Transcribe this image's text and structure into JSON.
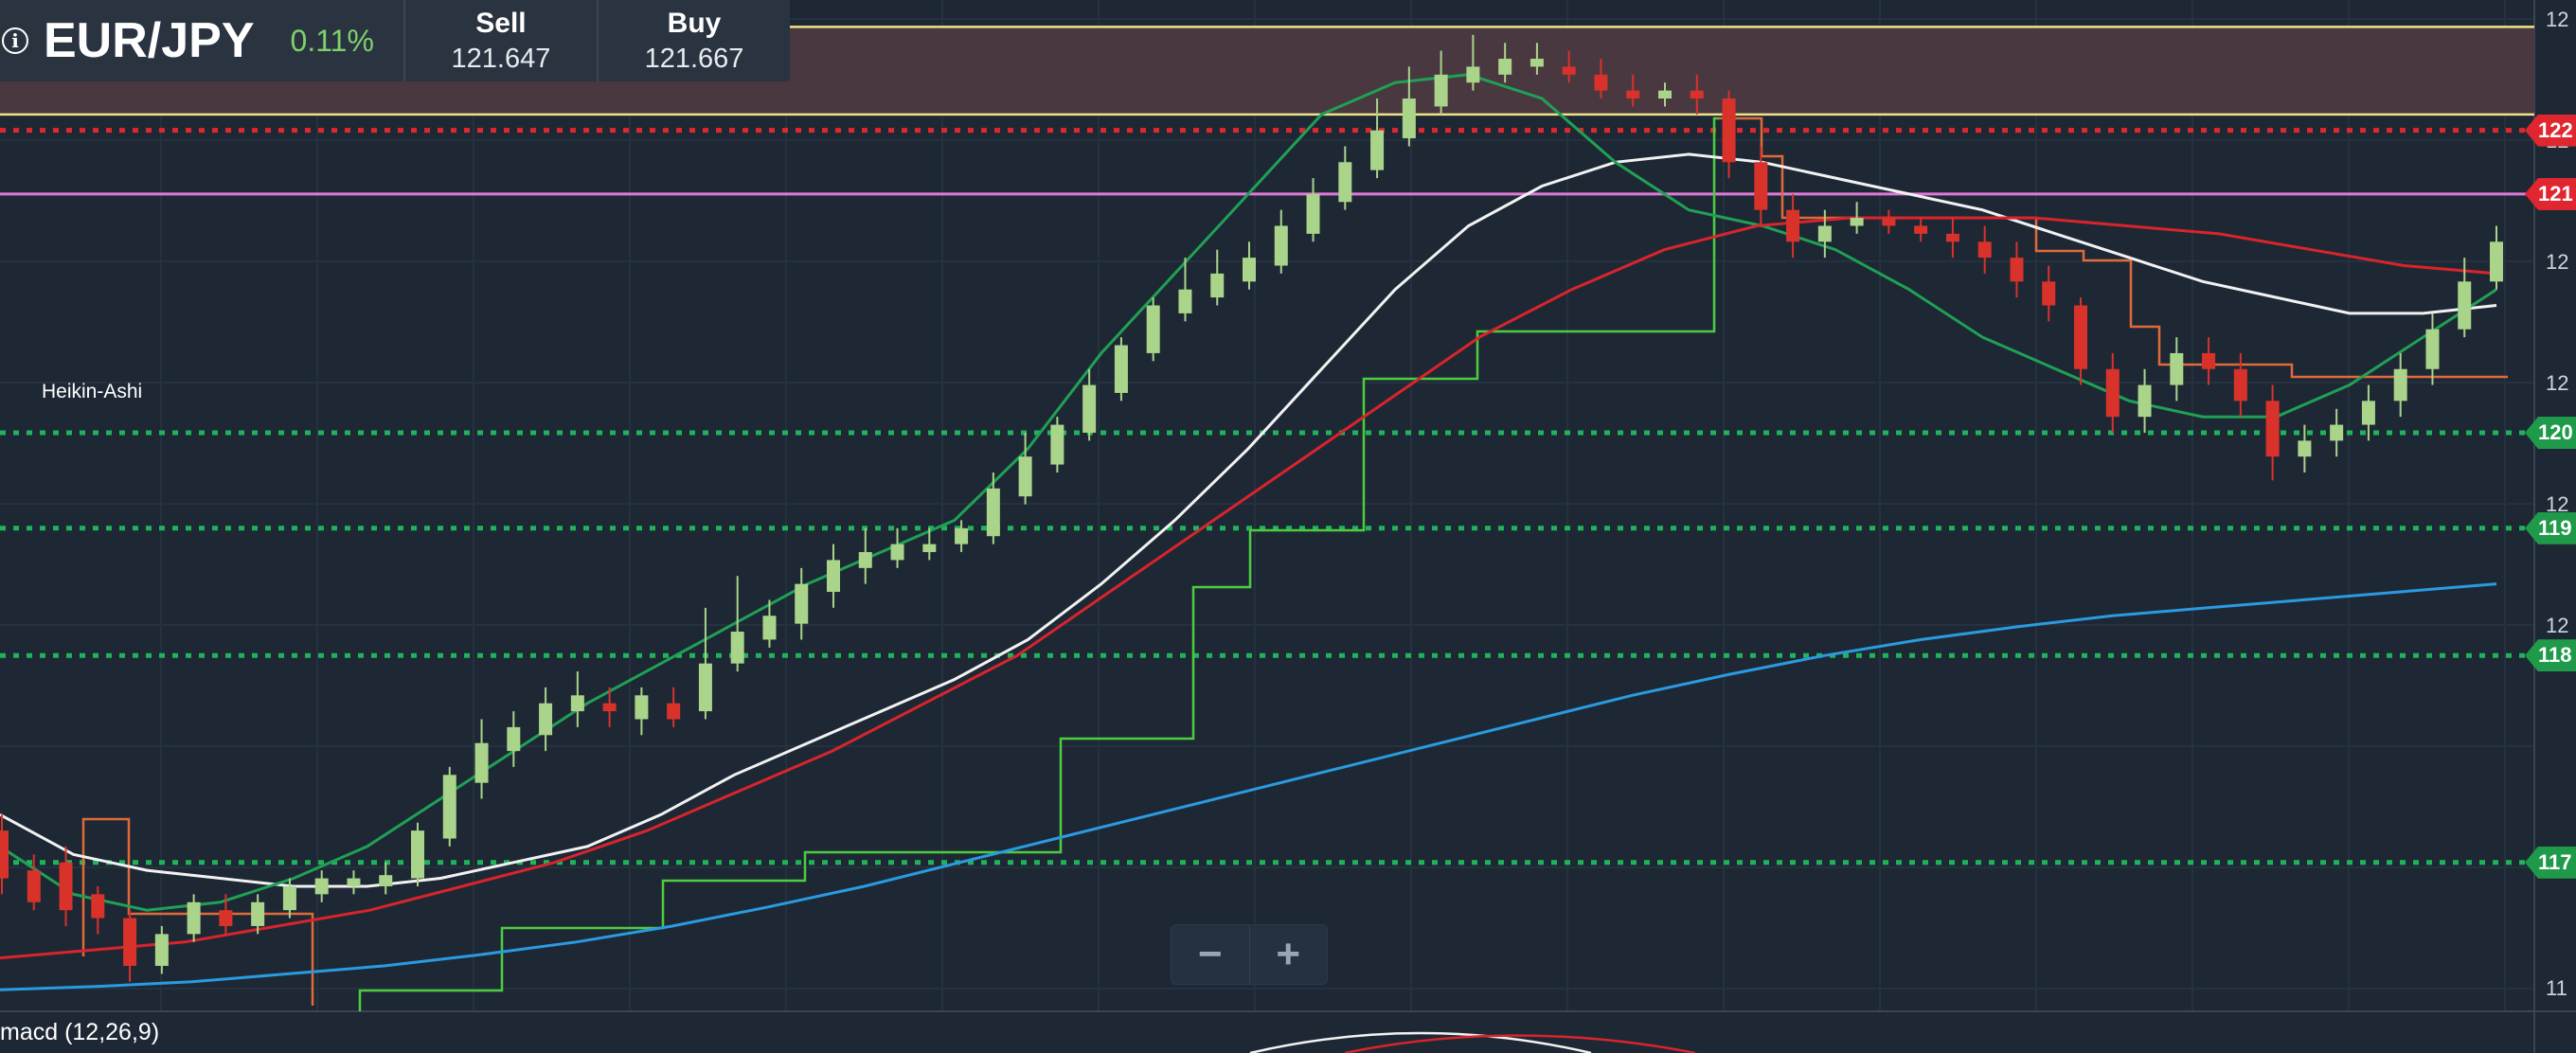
{
  "quote": {
    "symbol": "EUR/JPY",
    "change": "0.11%",
    "sell_label": "Sell",
    "sell_value": "121.647",
    "buy_label": "Buy",
    "buy_value": "121.667"
  },
  "study_label": "Heikin-Ashi",
  "macd_label": "macd (12,26,9)",
  "zoom": {
    "minus": "−",
    "plus": "+"
  },
  "icons": {
    "info": "info-icon",
    "zoom_out": "minus-icon",
    "zoom_in": "plus-icon"
  },
  "axis_ticks": [
    "12",
    "12",
    "12",
    "12",
    "12",
    "12",
    "11",
    "11",
    "11"
  ],
  "price_tags": [
    {
      "text": "122",
      "color": "#e0272f"
    },
    {
      "text": "121",
      "color": "#e0272f"
    },
    {
      "text": "120",
      "color": "#1f9a4a"
    },
    {
      "text": "119",
      "color": "#1f9a4a"
    },
    {
      "text": "118",
      "color": "#1f9a4a"
    },
    {
      "text": "117",
      "color": "#1f9a4a"
    }
  ],
  "colors": {
    "background": "#1e2835",
    "bull": "#a9d48a",
    "bear": "#d9322b",
    "ma_white": "#f2f2f2",
    "ma_green": "#1fa155",
    "ma_red": "#d9242c",
    "ma_blue": "#2a9be0",
    "step_green": "#4ccd3e",
    "step_orange": "#e06a3a",
    "resistance": "#e0272f",
    "support": "#1fb35a",
    "band": "#493840",
    "band_edge": "#efe28a",
    "hline": "#e07ad8"
  },
  "chart_data": {
    "type": "candlestick",
    "instrument": "EUR/JPY",
    "style": "Heikin-Ashi",
    "y_range": [
      116.6,
      122.8
    ],
    "horizontal_levels": {
      "resistance": [
        122.1
      ],
      "support": [
        120.2,
        119.6,
        118.8,
        117.5
      ],
      "band": [
        122.2,
        122.75
      ],
      "reference": [
        121.7
      ]
    },
    "candles": [
      {
        "o": 117.7,
        "c": 117.4,
        "h": 117.8,
        "l": 117.3
      },
      {
        "o": 117.45,
        "c": 117.25,
        "h": 117.55,
        "l": 117.2
      },
      {
        "o": 117.5,
        "c": 117.2,
        "h": 117.6,
        "l": 117.1
      },
      {
        "o": 117.3,
        "c": 117.15,
        "h": 117.35,
        "l": 117.05
      },
      {
        "o": 117.15,
        "c": 116.85,
        "h": 117.2,
        "l": 116.75
      },
      {
        "o": 116.85,
        "c": 117.05,
        "h": 117.1,
        "l": 116.8
      },
      {
        "o": 117.05,
        "c": 117.25,
        "h": 117.3,
        "l": 117.0
      },
      {
        "o": 117.2,
        "c": 117.1,
        "h": 117.3,
        "l": 117.05
      },
      {
        "o": 117.1,
        "c": 117.25,
        "h": 117.3,
        "l": 117.05
      },
      {
        "o": 117.2,
        "c": 117.35,
        "h": 117.4,
        "l": 117.15
      },
      {
        "o": 117.3,
        "c": 117.4,
        "h": 117.45,
        "l": 117.25
      },
      {
        "o": 117.35,
        "c": 117.4,
        "h": 117.45,
        "l": 117.3
      },
      {
        "o": 117.35,
        "c": 117.42,
        "h": 117.5,
        "l": 117.3
      },
      {
        "o": 117.4,
        "c": 117.7,
        "h": 117.75,
        "l": 117.35
      },
      {
        "o": 117.65,
        "c": 118.05,
        "h": 118.1,
        "l": 117.6
      },
      {
        "o": 118.0,
        "c": 118.25,
        "h": 118.4,
        "l": 117.9
      },
      {
        "o": 118.2,
        "c": 118.35,
        "h": 118.45,
        "l": 118.1
      },
      {
        "o": 118.3,
        "c": 118.5,
        "h": 118.6,
        "l": 118.2
      },
      {
        "o": 118.45,
        "c": 118.55,
        "h": 118.7,
        "l": 118.35
      },
      {
        "o": 118.5,
        "c": 118.45,
        "h": 118.6,
        "l": 118.35
      },
      {
        "o": 118.4,
        "c": 118.55,
        "h": 118.6,
        "l": 118.3
      },
      {
        "o": 118.5,
        "c": 118.4,
        "h": 118.6,
        "l": 118.35
      },
      {
        "o": 118.45,
        "c": 118.75,
        "h": 119.1,
        "l": 118.4
      },
      {
        "o": 118.75,
        "c": 118.95,
        "h": 119.3,
        "l": 118.7
      },
      {
        "o": 118.9,
        "c": 119.05,
        "h": 119.15,
        "l": 118.85
      },
      {
        "o": 119.0,
        "c": 119.25,
        "h": 119.35,
        "l": 118.9
      },
      {
        "o": 119.2,
        "c": 119.4,
        "h": 119.5,
        "l": 119.1
      },
      {
        "o": 119.35,
        "c": 119.45,
        "h": 119.6,
        "l": 119.25
      },
      {
        "o": 119.4,
        "c": 119.5,
        "h": 119.6,
        "l": 119.35
      },
      {
        "o": 119.45,
        "c": 119.5,
        "h": 119.6,
        "l": 119.4
      },
      {
        "o": 119.5,
        "c": 119.6,
        "h": 119.65,
        "l": 119.45
      },
      {
        "o": 119.55,
        "c": 119.85,
        "h": 119.95,
        "l": 119.5
      },
      {
        "o": 119.8,
        "c": 120.05,
        "h": 120.2,
        "l": 119.75
      },
      {
        "o": 120.0,
        "c": 120.25,
        "h": 120.3,
        "l": 119.95
      },
      {
        "o": 120.2,
        "c": 120.5,
        "h": 120.6,
        "l": 120.15
      },
      {
        "o": 120.45,
        "c": 120.75,
        "h": 120.8,
        "l": 120.4
      },
      {
        "o": 120.7,
        "c": 121.0,
        "h": 121.05,
        "l": 120.65
      },
      {
        "o": 120.95,
        "c": 121.1,
        "h": 121.3,
        "l": 120.9
      },
      {
        "o": 121.05,
        "c": 121.2,
        "h": 121.35,
        "l": 121.0
      },
      {
        "o": 121.15,
        "c": 121.3,
        "h": 121.4,
        "l": 121.1
      },
      {
        "o": 121.25,
        "c": 121.5,
        "h": 121.6,
        "l": 121.2
      },
      {
        "o": 121.45,
        "c": 121.7,
        "h": 121.8,
        "l": 121.4
      },
      {
        "o": 121.65,
        "c": 121.9,
        "h": 122.0,
        "l": 121.6
      },
      {
        "o": 121.85,
        "c": 122.1,
        "h": 122.3,
        "l": 121.8
      },
      {
        "o": 122.05,
        "c": 122.3,
        "h": 122.5,
        "l": 122.0
      },
      {
        "o": 122.25,
        "c": 122.45,
        "h": 122.6,
        "l": 122.2
      },
      {
        "o": 122.4,
        "c": 122.5,
        "h": 122.7,
        "l": 122.35
      },
      {
        "o": 122.45,
        "c": 122.55,
        "h": 122.65,
        "l": 122.4
      },
      {
        "o": 122.5,
        "c": 122.55,
        "h": 122.65,
        "l": 122.45
      },
      {
        "o": 122.5,
        "c": 122.45,
        "h": 122.6,
        "l": 122.4
      },
      {
        "o": 122.45,
        "c": 122.35,
        "h": 122.55,
        "l": 122.3
      },
      {
        "o": 122.35,
        "c": 122.3,
        "h": 122.45,
        "l": 122.25
      },
      {
        "o": 122.3,
        "c": 122.35,
        "h": 122.4,
        "l": 122.25
      },
      {
        "o": 122.35,
        "c": 122.3,
        "h": 122.45,
        "l": 122.2
      },
      {
        "o": 122.3,
        "c": 121.9,
        "h": 122.35,
        "l": 121.8
      },
      {
        "o": 121.9,
        "c": 121.6,
        "h": 122.0,
        "l": 121.5
      },
      {
        "o": 121.6,
        "c": 121.4,
        "h": 121.7,
        "l": 121.3
      },
      {
        "o": 121.4,
        "c": 121.5,
        "h": 121.6,
        "l": 121.3
      },
      {
        "o": 121.5,
        "c": 121.55,
        "h": 121.65,
        "l": 121.45
      },
      {
        "o": 121.55,
        "c": 121.5,
        "h": 121.6,
        "l": 121.45
      },
      {
        "o": 121.5,
        "c": 121.45,
        "h": 121.55,
        "l": 121.4
      },
      {
        "o": 121.45,
        "c": 121.4,
        "h": 121.55,
        "l": 121.3
      },
      {
        "o": 121.4,
        "c": 121.3,
        "h": 121.5,
        "l": 121.2
      },
      {
        "o": 121.3,
        "c": 121.15,
        "h": 121.4,
        "l": 121.05
      },
      {
        "o": 121.15,
        "c": 121.0,
        "h": 121.25,
        "l": 120.9
      },
      {
        "o": 121.0,
        "c": 120.6,
        "h": 121.05,
        "l": 120.5
      },
      {
        "o": 120.6,
        "c": 120.3,
        "h": 120.7,
        "l": 120.2
      },
      {
        "o": 120.3,
        "c": 120.5,
        "h": 120.6,
        "l": 120.2
      },
      {
        "o": 120.5,
        "c": 120.7,
        "h": 120.8,
        "l": 120.4
      },
      {
        "o": 120.7,
        "c": 120.6,
        "h": 120.8,
        "l": 120.5
      },
      {
        "o": 120.6,
        "c": 120.4,
        "h": 120.7,
        "l": 120.3
      },
      {
        "o": 120.4,
        "c": 120.05,
        "h": 120.5,
        "l": 119.9
      },
      {
        "o": 120.05,
        "c": 120.15,
        "h": 120.25,
        "l": 119.95
      },
      {
        "o": 120.15,
        "c": 120.25,
        "h": 120.35,
        "l": 120.05
      },
      {
        "o": 120.25,
        "c": 120.4,
        "h": 120.5,
        "l": 120.15
      },
      {
        "o": 120.4,
        "c": 120.6,
        "h": 120.7,
        "l": 120.3
      },
      {
        "o": 120.6,
        "c": 120.85,
        "h": 120.95,
        "l": 120.5
      },
      {
        "o": 120.85,
        "c": 121.15,
        "h": 121.3,
        "l": 120.8
      },
      {
        "o": 121.15,
        "c": 121.4,
        "h": 121.5,
        "l": 121.1
      }
    ],
    "lines": [
      {
        "name": "",
        "color": "#f2f2f2",
        "values": [
          117.8,
          117.55,
          117.45,
          117.4,
          117.35,
          117.35,
          117.4,
          117.5,
          117.6,
          117.8,
          118.05,
          118.25,
          118.45,
          118.65,
          118.9,
          119.25,
          119.65,
          120.1,
          120.6,
          121.1,
          121.5,
          121.75,
          121.9,
          121.95,
          121.9,
          121.8,
          121.7,
          121.6,
          121.45,
          121.3,
          121.15,
          121.05,
          120.95,
          120.95,
          121.0
        ]
      },
      {
        "name": "",
        "color": "#1fa155",
        "values": [
          117.6,
          117.3,
          117.2,
          117.25,
          117.4,
          117.6,
          117.9,
          118.2,
          118.5,
          118.75,
          119.0,
          119.25,
          119.45,
          119.65,
          120.1,
          120.7,
          121.2,
          121.7,
          122.2,
          122.4,
          122.45,
          122.3,
          121.9,
          121.6,
          121.5,
          121.35,
          121.1,
          120.8,
          120.6,
          120.4,
          120.3,
          120.3,
          120.5,
          120.8,
          121.1
        ]
      },
      {
        "name": "",
        "color": "#d9242c",
        "values": [
          116.9,
          116.95,
          117.0,
          117.1,
          117.2,
          117.35,
          117.5,
          117.7,
          117.95,
          118.2,
          118.5,
          118.8,
          119.2,
          119.6,
          120.0,
          120.4,
          120.8,
          121.1,
          121.35,
          121.5,
          121.55,
          121.55,
          121.55,
          121.5,
          121.45,
          121.35,
          121.25,
          121.2
        ]
      },
      {
        "name": "",
        "color": "#2a9be0",
        "values": [
          116.7,
          116.72,
          116.75,
          116.8,
          116.85,
          116.92,
          117.0,
          117.1,
          117.22,
          117.35,
          117.5,
          117.65,
          117.8,
          117.95,
          118.1,
          118.25,
          118.4,
          118.55,
          118.68,
          118.8,
          118.9,
          118.98,
          119.05,
          119.1,
          119.15,
          119.2,
          119.25
        ]
      }
    ]
  }
}
